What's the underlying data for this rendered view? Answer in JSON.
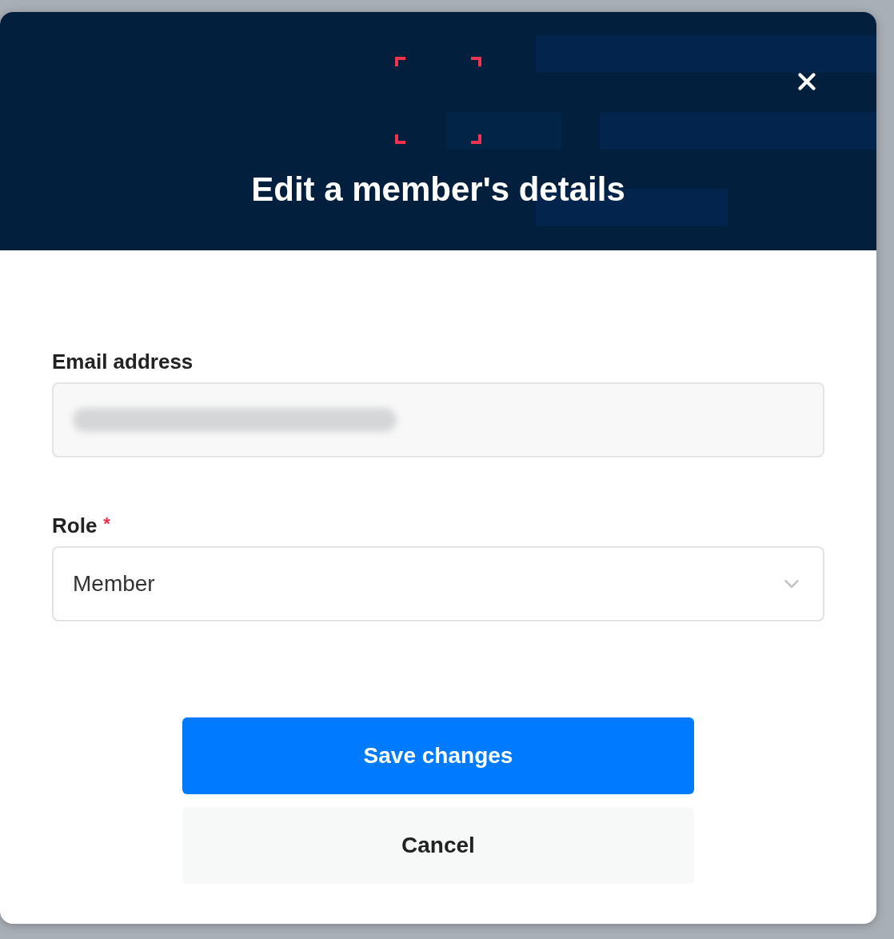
{
  "dialog": {
    "title": "Edit a member's details",
    "fields": [
      {
        "kind": "text",
        "label": "Email address",
        "redacted": true
      },
      {
        "kind": "select",
        "label": "Role",
        "required_mark": "*",
        "value": "Member"
      }
    ],
    "buttons": [
      {
        "kind": "primary",
        "label": "Save changes"
      },
      {
        "kind": "secondary",
        "label": "Cancel"
      }
    ]
  }
}
